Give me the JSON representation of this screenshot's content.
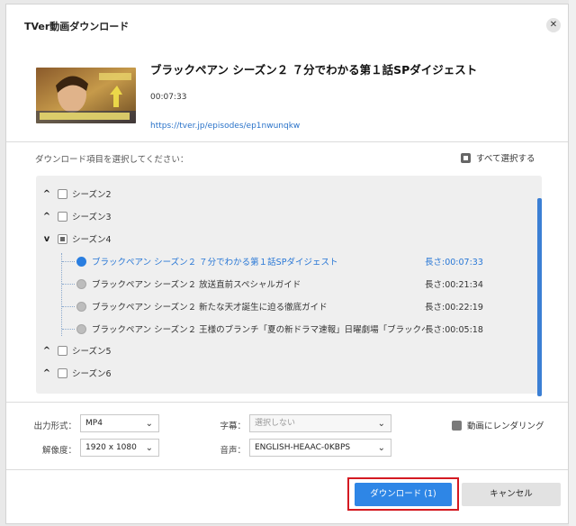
{
  "dialog": {
    "title": "TVer動画ダウンロード",
    "close_glyph": "✕"
  },
  "episode": {
    "title": "ブラックペアン シーズン２ ７分でわかる第１話SPダイジェスト",
    "duration": "00:07:33",
    "url": "https://tver.jp/episodes/ep1nwunqkw"
  },
  "selection": {
    "prompt": "ダウンロード項目を選択してください：",
    "select_all": "すべて選択する"
  },
  "tree": {
    "seasons": [
      {
        "label": "シーズン2",
        "expanded": false
      },
      {
        "label": "シーズン3",
        "expanded": false
      },
      {
        "label": "シーズン4",
        "expanded": true
      },
      {
        "label": "シーズン5",
        "expanded": false
      },
      {
        "label": "シーズン6",
        "expanded": false
      }
    ],
    "episodes": [
      {
        "name": "ブラックペアン シーズン２ ７分でわかる第１話SPダイジェスト",
        "length": "長さ:00:07:33",
        "selected": true
      },
      {
        "name": "ブラックペアン シーズン２ 放送直前スペシャルガイド",
        "length": "長さ:00:21:34",
        "selected": false
      },
      {
        "name": "ブラックペアン シーズン２ 新たな天才誕生に迫る徹底ガイド",
        "length": "長さ:00:22:19",
        "selected": false
      },
      {
        "name": "ブラックペアン シーズン２ 王様のブランチ「夏の新ドラマ速報」日曜劇場「ブラックペア...",
        "length": "長さ:00:05:18",
        "selected": false
      }
    ],
    "chevron_up": "^",
    "chevron_down": "v"
  },
  "options": {
    "format_label": "出力形式：",
    "format_value": "MP4",
    "resolution_label": "解像度：",
    "resolution_value": "1920 x 1080",
    "subtitle_label": "字幕：",
    "subtitle_value": "選択しない",
    "audio_label": "音声：",
    "audio_value": "ENGLISH-HEAAC-0KBPS",
    "render_label": "動画にレンダリング",
    "arrow": "⌄"
  },
  "buttons": {
    "download": "ダウンロード (1)",
    "cancel": "キャンセル"
  },
  "colors": {
    "accent": "#2e86e6",
    "highlight": "#d41a22",
    "link": "#2a73c9"
  }
}
